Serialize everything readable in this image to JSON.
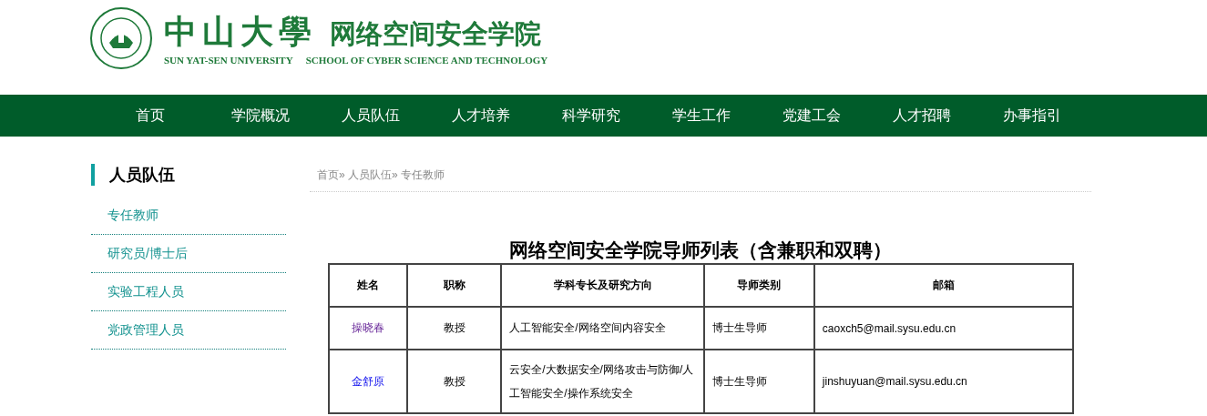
{
  "header": {
    "university_name": "中山大學",
    "university_name_en": "SUN YAT-SEN UNIVERSITY",
    "school_name": "网络空间安全学院",
    "school_name_en": "SCHOOL OF CYBER SCIENCE AND TECHNOLOGY"
  },
  "nav": [
    {
      "label": "首页"
    },
    {
      "label": "学院概况"
    },
    {
      "label": "人员队伍"
    },
    {
      "label": "人才培养"
    },
    {
      "label": "科学研究"
    },
    {
      "label": "学生工作"
    },
    {
      "label": "党建工会"
    },
    {
      "label": "人才招聘"
    },
    {
      "label": "办事指引"
    }
  ],
  "sidebar": {
    "title": "人员队伍",
    "items": [
      {
        "label": "专任教师"
      },
      {
        "label": "研究员/博士后"
      },
      {
        "label": "实验工程人员"
      },
      {
        "label": "党政管理人员"
      }
    ]
  },
  "breadcrumb": [
    {
      "label": "首页"
    },
    {
      "label": "人员队伍"
    },
    {
      "label": "专任教师"
    }
  ],
  "breadcrumb_separator": "»",
  "table": {
    "title": "网络空间安全学院导师列表（含兼职和双聘）",
    "columns": [
      "姓名",
      "职称",
      "学科专长及研究方向",
      "导师类别",
      "邮箱"
    ],
    "rows": [
      {
        "name": "操晓春",
        "visited": true,
        "title": "教授",
        "field": "人工智能安全/网络空间内容安全",
        "category": "博士生导师",
        "email": "caoxch5@mail.sysu.edu.cn"
      },
      {
        "name": "金舒原",
        "visited": false,
        "title": "教授",
        "field": "云安全/大数据安全/网络攻击与防御/人工智能安全/操作系统安全",
        "category": "博士生导师",
        "email": "jinshuyuan@mail.sysu.edu.cn"
      }
    ]
  }
}
